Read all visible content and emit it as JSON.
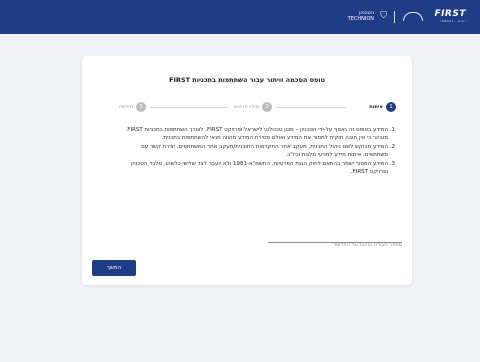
{
  "header": {
    "technion_he": "הטכניון",
    "technion_en": "TECHNION",
    "first_logo": "FIRST",
    "first_sub": "ISRAEL · יזמת"
  },
  "form": {
    "title": "טופס הסכמה וויתור עבור השתתפות בתכניות FIRST",
    "steps": [
      {
        "number": "1",
        "label": "איתות",
        "state": "active"
      },
      {
        "number": "2",
        "label": "מילוי פרטים",
        "state": "inactive"
      },
      {
        "number": "3",
        "label": "חתימה",
        "state": "inactive"
      }
    ],
    "terms": [
      "המידע בטופס זה נאסף על-ידי הטכניון – מכון טכנולוגי לישראל ופרויקט FIRST, לצורך השתתפות בתכניות FIRST. מובהר כי אין חובה חוקית למסור את המידע ואולם מסירת המידע מהווה תנאי להשתתפות בתכנית.",
      "המידע מבוקש לשם ניהול התכנית, מעקב אחר התקדמות התוכנית/מעקב אחר המשתתפים, יצירת קשר עם משתתפים, אימות מידע למניעי מלגות וכיו\"ב.",
      "המידע המסור ישמר בהתאם לחוק הגנת הפרטיות, התשמ\"א-1981 ולא יועבר לצד שלישי כלשהו, מלבד הטכניון ופרויקט FIRST."
    ],
    "id_placeholder": "מספר תעודת הזהות של התלמיד",
    "id_value": "",
    "continue_label": "המשך"
  }
}
